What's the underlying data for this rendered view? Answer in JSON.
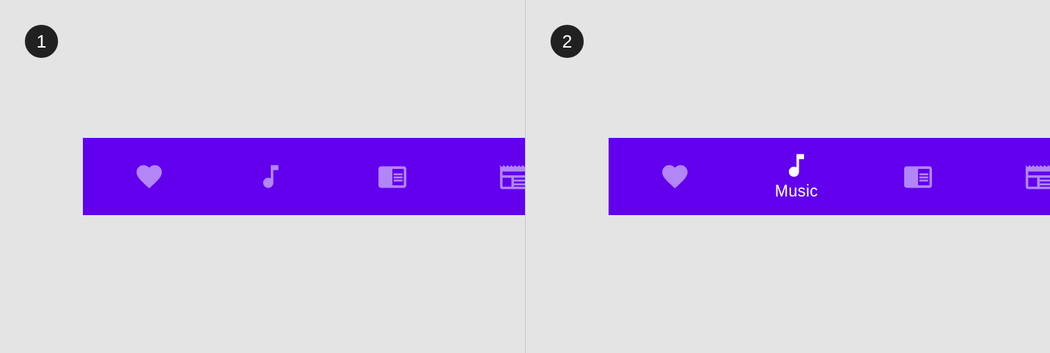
{
  "panels": [
    {
      "number": "1",
      "nav_items": [
        {
          "kind": "heart",
          "selected": false
        },
        {
          "kind": "note",
          "selected": false
        },
        {
          "kind": "reader",
          "selected": false
        },
        {
          "kind": "newspaper",
          "selected": false
        }
      ]
    },
    {
      "number": "2",
      "nav_items": [
        {
          "kind": "heart",
          "selected": false
        },
        {
          "kind": "note",
          "selected": true,
          "label": "Music"
        },
        {
          "kind": "reader",
          "selected": false
        },
        {
          "kind": "newspaper",
          "selected": false
        }
      ]
    }
  ]
}
